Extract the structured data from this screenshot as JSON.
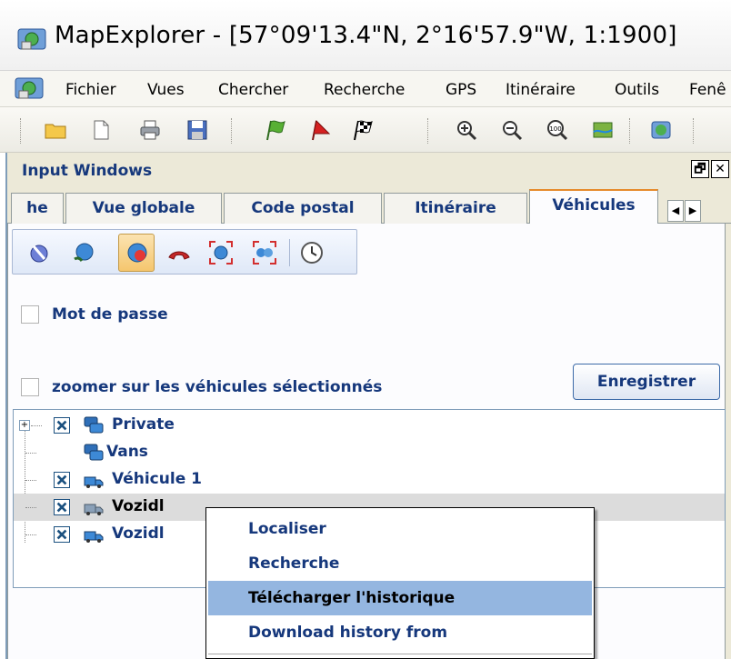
{
  "window": {
    "title": "MapExplorer - [57°09'13.4\"N, 2°16'57.9\"W, 1:1900]"
  },
  "menu": {
    "items": [
      "Fichier",
      "Vues",
      "Chercher",
      "Recherche",
      "GPS",
      "Itinéraire",
      "Outils",
      "Fenê"
    ]
  },
  "toolbar": {
    "icons": [
      "open-folder-icon",
      "new-document-icon",
      "print-icon",
      "save-icon",
      "green-flag-icon",
      "red-flag-icon",
      "checkered-flag-icon",
      "zoom-in-icon",
      "zoom-out-icon",
      "zoom-100-icon",
      "map-view-icon",
      "globe-icon"
    ]
  },
  "panel": {
    "title": "Input Windows",
    "restore_glyph": "🗗",
    "close_glyph": "✕"
  },
  "tabs": {
    "items": [
      "he",
      "Vue globale",
      "Code postal",
      "Itinéraire",
      "Véhicules"
    ],
    "active": "Véhicules",
    "prev_glyph": "◀",
    "next_glyph": "▶"
  },
  "vehicle_toolbar": {
    "icons": [
      "satellite-icon",
      "phone-satellite-icon",
      "globe-user-icon",
      "phone-hangup-icon",
      "target-scan-icon",
      "group-scan-icon",
      "clock-icon"
    ],
    "active_index": 2
  },
  "form": {
    "password_label": "Mot de passe",
    "zoom_label": "zoomer sur les véhicules sélectionnés",
    "save_button": "Enregistrer"
  },
  "tree": {
    "rows": [
      {
        "label": "Private",
        "checked": true,
        "expander": "+"
      },
      {
        "label": "Vans",
        "checked": false
      },
      {
        "label": "Véhicule 1",
        "checked": true
      },
      {
        "label": "Vozidl",
        "checked": true,
        "selected": true
      },
      {
        "label": "Vozidl",
        "checked": true
      }
    ]
  },
  "context_menu": {
    "items": [
      "Localiser",
      "Recherche",
      "Télécharger l'historique",
      "Download history from"
    ],
    "highlighted": "Télécharger l'historique"
  },
  "colors": {
    "accent_text": "#16387c",
    "highlight": "#94b6e0",
    "active_tab_border": "#e68b2c"
  }
}
